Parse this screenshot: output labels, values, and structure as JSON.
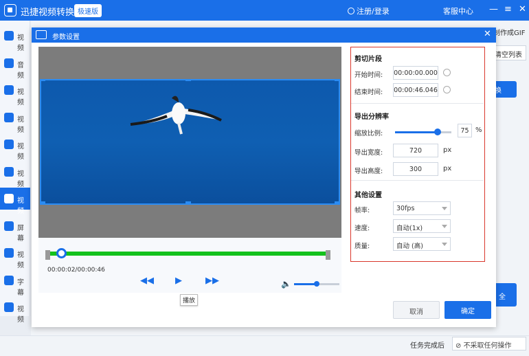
{
  "app": {
    "title": "迅捷视频转换器",
    "edition": "极速版",
    "login": "注册/登录",
    "service": "客服中心",
    "min": "—",
    "menu": "≡",
    "close": "✕"
  },
  "sidebar": {
    "items": [
      {
        "label": "视频",
        "active": false
      },
      {
        "label": "音频",
        "active": false
      },
      {
        "label": "视频",
        "active": false
      },
      {
        "label": "视频",
        "active": false
      },
      {
        "label": "视频",
        "active": false
      },
      {
        "label": "视频",
        "active": false
      },
      {
        "label": "视频",
        "active": true
      },
      {
        "label": "屏幕",
        "active": false
      },
      {
        "label": "视频",
        "active": false
      },
      {
        "label": "字幕",
        "active": false
      },
      {
        "label": "视频",
        "active": false
      }
    ]
  },
  "main": {
    "gif_tab": "制作成GIF",
    "clear_list": "清空列表",
    "convert_btn": "换",
    "convert_all_btn": "全",
    "after_task_label": "任务完成后",
    "after_task_value": "不采取任何操作"
  },
  "dialog": {
    "title": "参数设置",
    "close": "✕",
    "time_text": "00:00:02/00:00:46",
    "progress": 0.05,
    "volume": 0.5,
    "tooltip": "播放",
    "controls": {
      "prev": "◀◀",
      "play": "▶",
      "next": "▶▶"
    },
    "clip": {
      "title": "剪切片段",
      "start_label": "开始时间:",
      "start_value": "00:00:00.000",
      "end_label": "结束时间:",
      "end_value": "00:00:46.046"
    },
    "resolution": {
      "title": "导出分辨率",
      "scale_label": "缩放比例:",
      "scale_value": "75",
      "scale_unit": "%",
      "scale_fraction": 0.75,
      "width_label": "导出宽度:",
      "width_value": "720",
      "height_label": "导出高度:",
      "height_value": "300",
      "px": "px"
    },
    "other": {
      "title": "其他设置",
      "fps_label": "帧率:",
      "fps_value": "30fps",
      "speed_label": "速度:",
      "speed_value": "自动(1x)",
      "quality_label": "质量:",
      "quality_value": "自动 (高)"
    },
    "cancel": "取消",
    "ok": "确定"
  },
  "colors": {
    "accent": "#1a6fe8",
    "highlight": "#d9362b",
    "track": "#14c21c"
  }
}
